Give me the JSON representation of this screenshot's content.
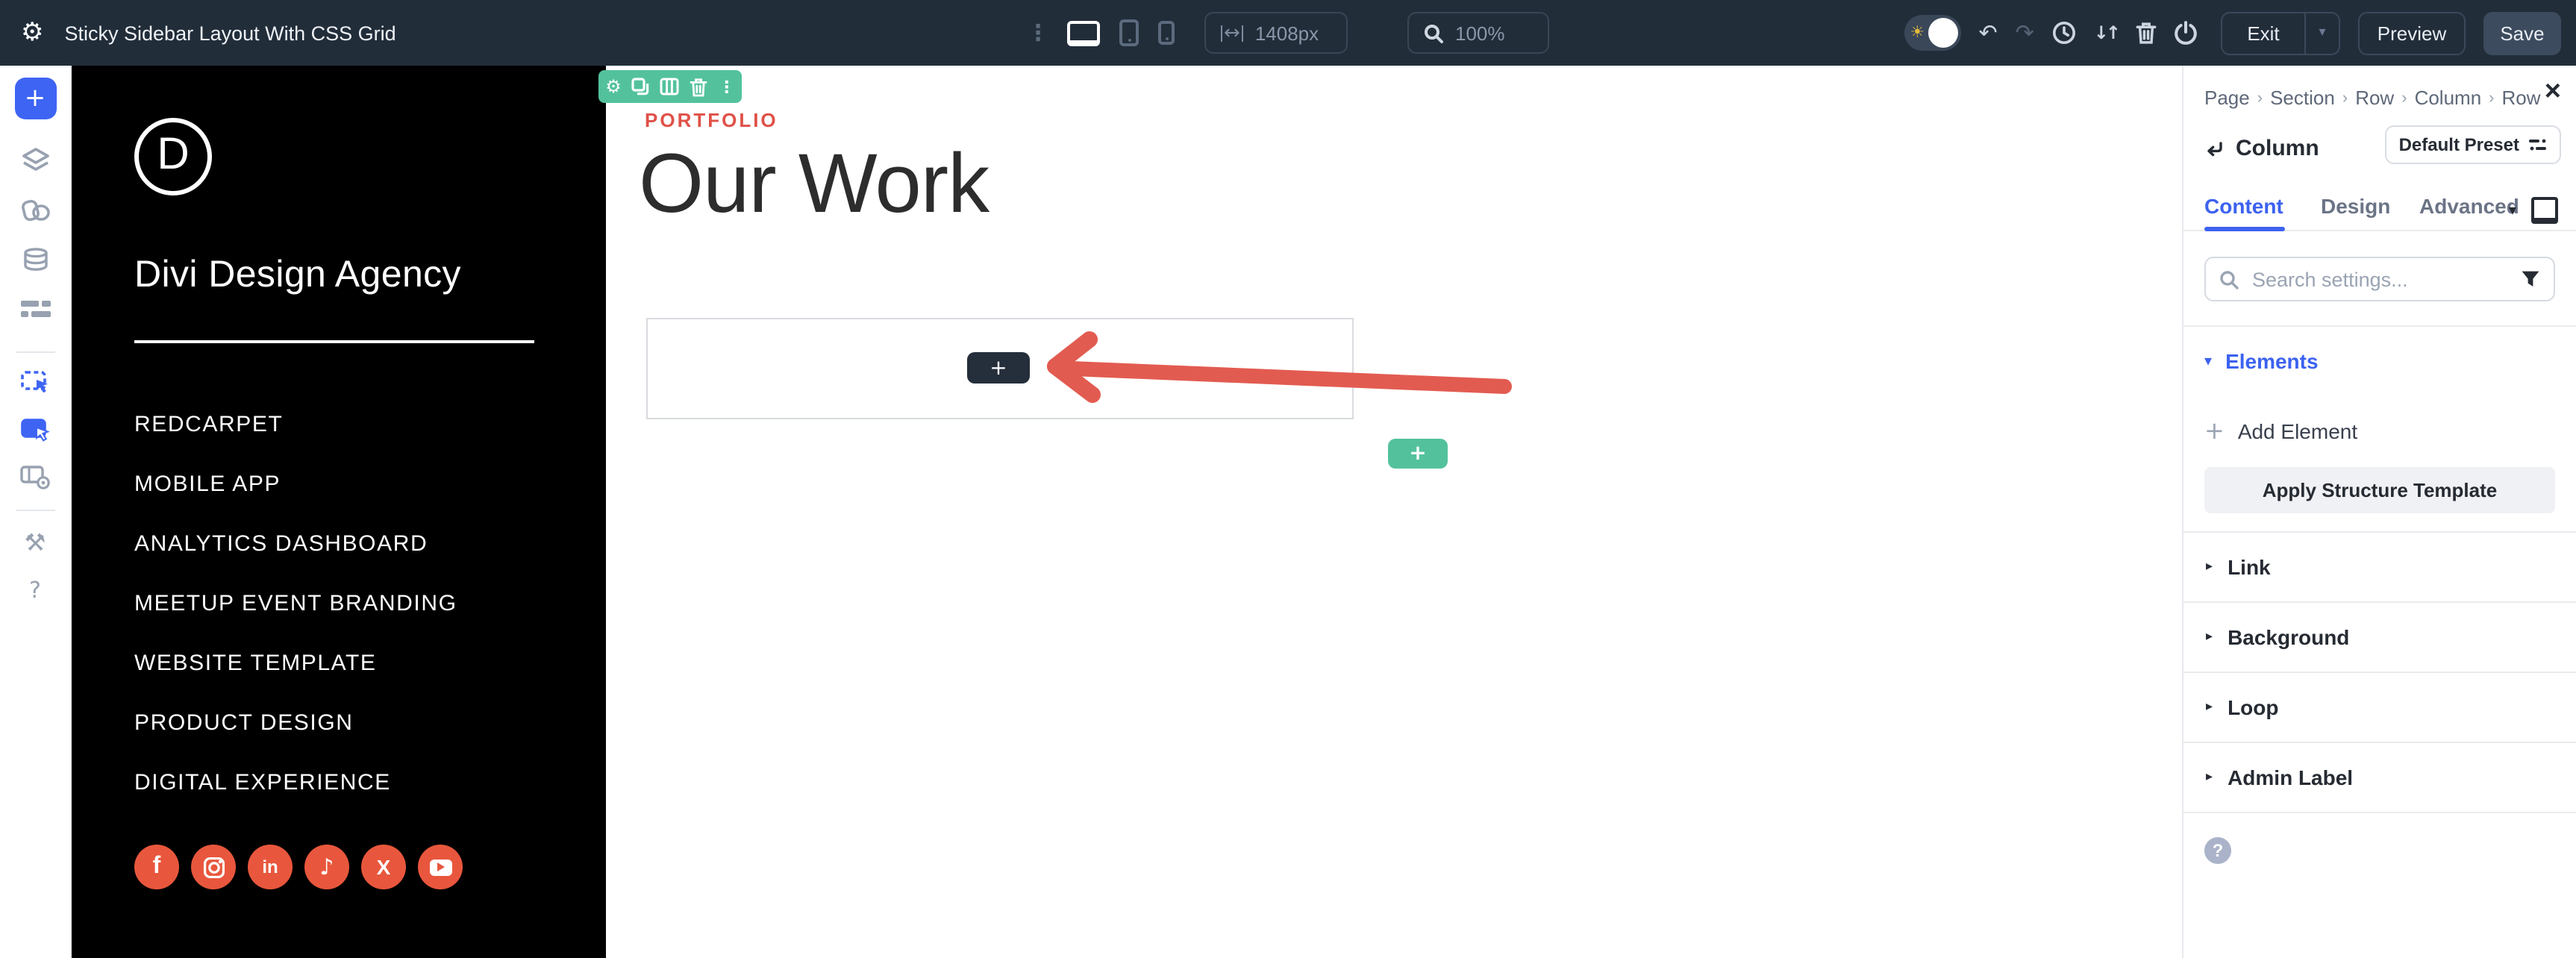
{
  "topbar": {
    "title": "Sticky Sidebar Layout With CSS Grid",
    "width_value": "1408px",
    "zoom_value": "100%",
    "exit_label": "Exit",
    "preview_label": "Preview",
    "save_label": "Save"
  },
  "icons": {
    "gear": "⚙",
    "menu_dots": "⋮",
    "undo": "↶",
    "redo": "↷",
    "sort": "↓↑",
    "width_arrows": "↔",
    "sun": "☀",
    "chevron_down": "▾",
    "chevron_right": "▸",
    "close": "×",
    "plus": "+",
    "help": "?",
    "tools": "⚒"
  },
  "left_toolbar": {
    "items": [
      "add",
      "layers",
      "shapes",
      "database",
      "layout",
      "hover-mode",
      "click-mode",
      "preview-box",
      "tools",
      "help"
    ]
  },
  "sidebar": {
    "logo_letter": "D",
    "brand": "Divi Design Agency",
    "nav": [
      "REDCARPET",
      "MOBILE APP",
      "ANALYTICS DASHBOARD",
      "MEETUP EVENT BRANDING",
      "WEBSITE TEMPLATE",
      "PRODUCT DESIGN",
      "DIGITAL EXPERIENCE"
    ],
    "social": [
      {
        "name": "facebook",
        "glyph": "f"
      },
      {
        "name": "instagram",
        "glyph": ""
      },
      {
        "name": "linkedin",
        "glyph": "in"
      },
      {
        "name": "tiktok",
        "glyph": "♪"
      },
      {
        "name": "x",
        "glyph": "X"
      },
      {
        "name": "youtube",
        "glyph": ""
      }
    ]
  },
  "canvas": {
    "eyebrow": "PORTFOLIO",
    "heading": "Our Work"
  },
  "panel": {
    "breadcrumb": [
      "Page",
      "Section",
      "Row",
      "Column",
      "Row"
    ],
    "crumb_sep": "›",
    "title": "Column",
    "preset_label": "Default Preset",
    "tabs": [
      "Content",
      "Design",
      "Advanced"
    ],
    "active_tab": "Content",
    "search_placeholder": "Search settings...",
    "elements_label": "Elements",
    "add_element_label": "Add Element",
    "apply_structure_label": "Apply Structure Template",
    "sections": [
      "Link",
      "Background",
      "Loop",
      "Admin Label"
    ]
  },
  "colors": {
    "topbar_bg": "#222d3a",
    "accent_blue": "#3c62f0",
    "builder_green": "#53c29c",
    "coral": "#e25b50",
    "social_orange": "#e8573d",
    "sidebar_bg": "#000000",
    "save_button": "#3d4b5e"
  }
}
